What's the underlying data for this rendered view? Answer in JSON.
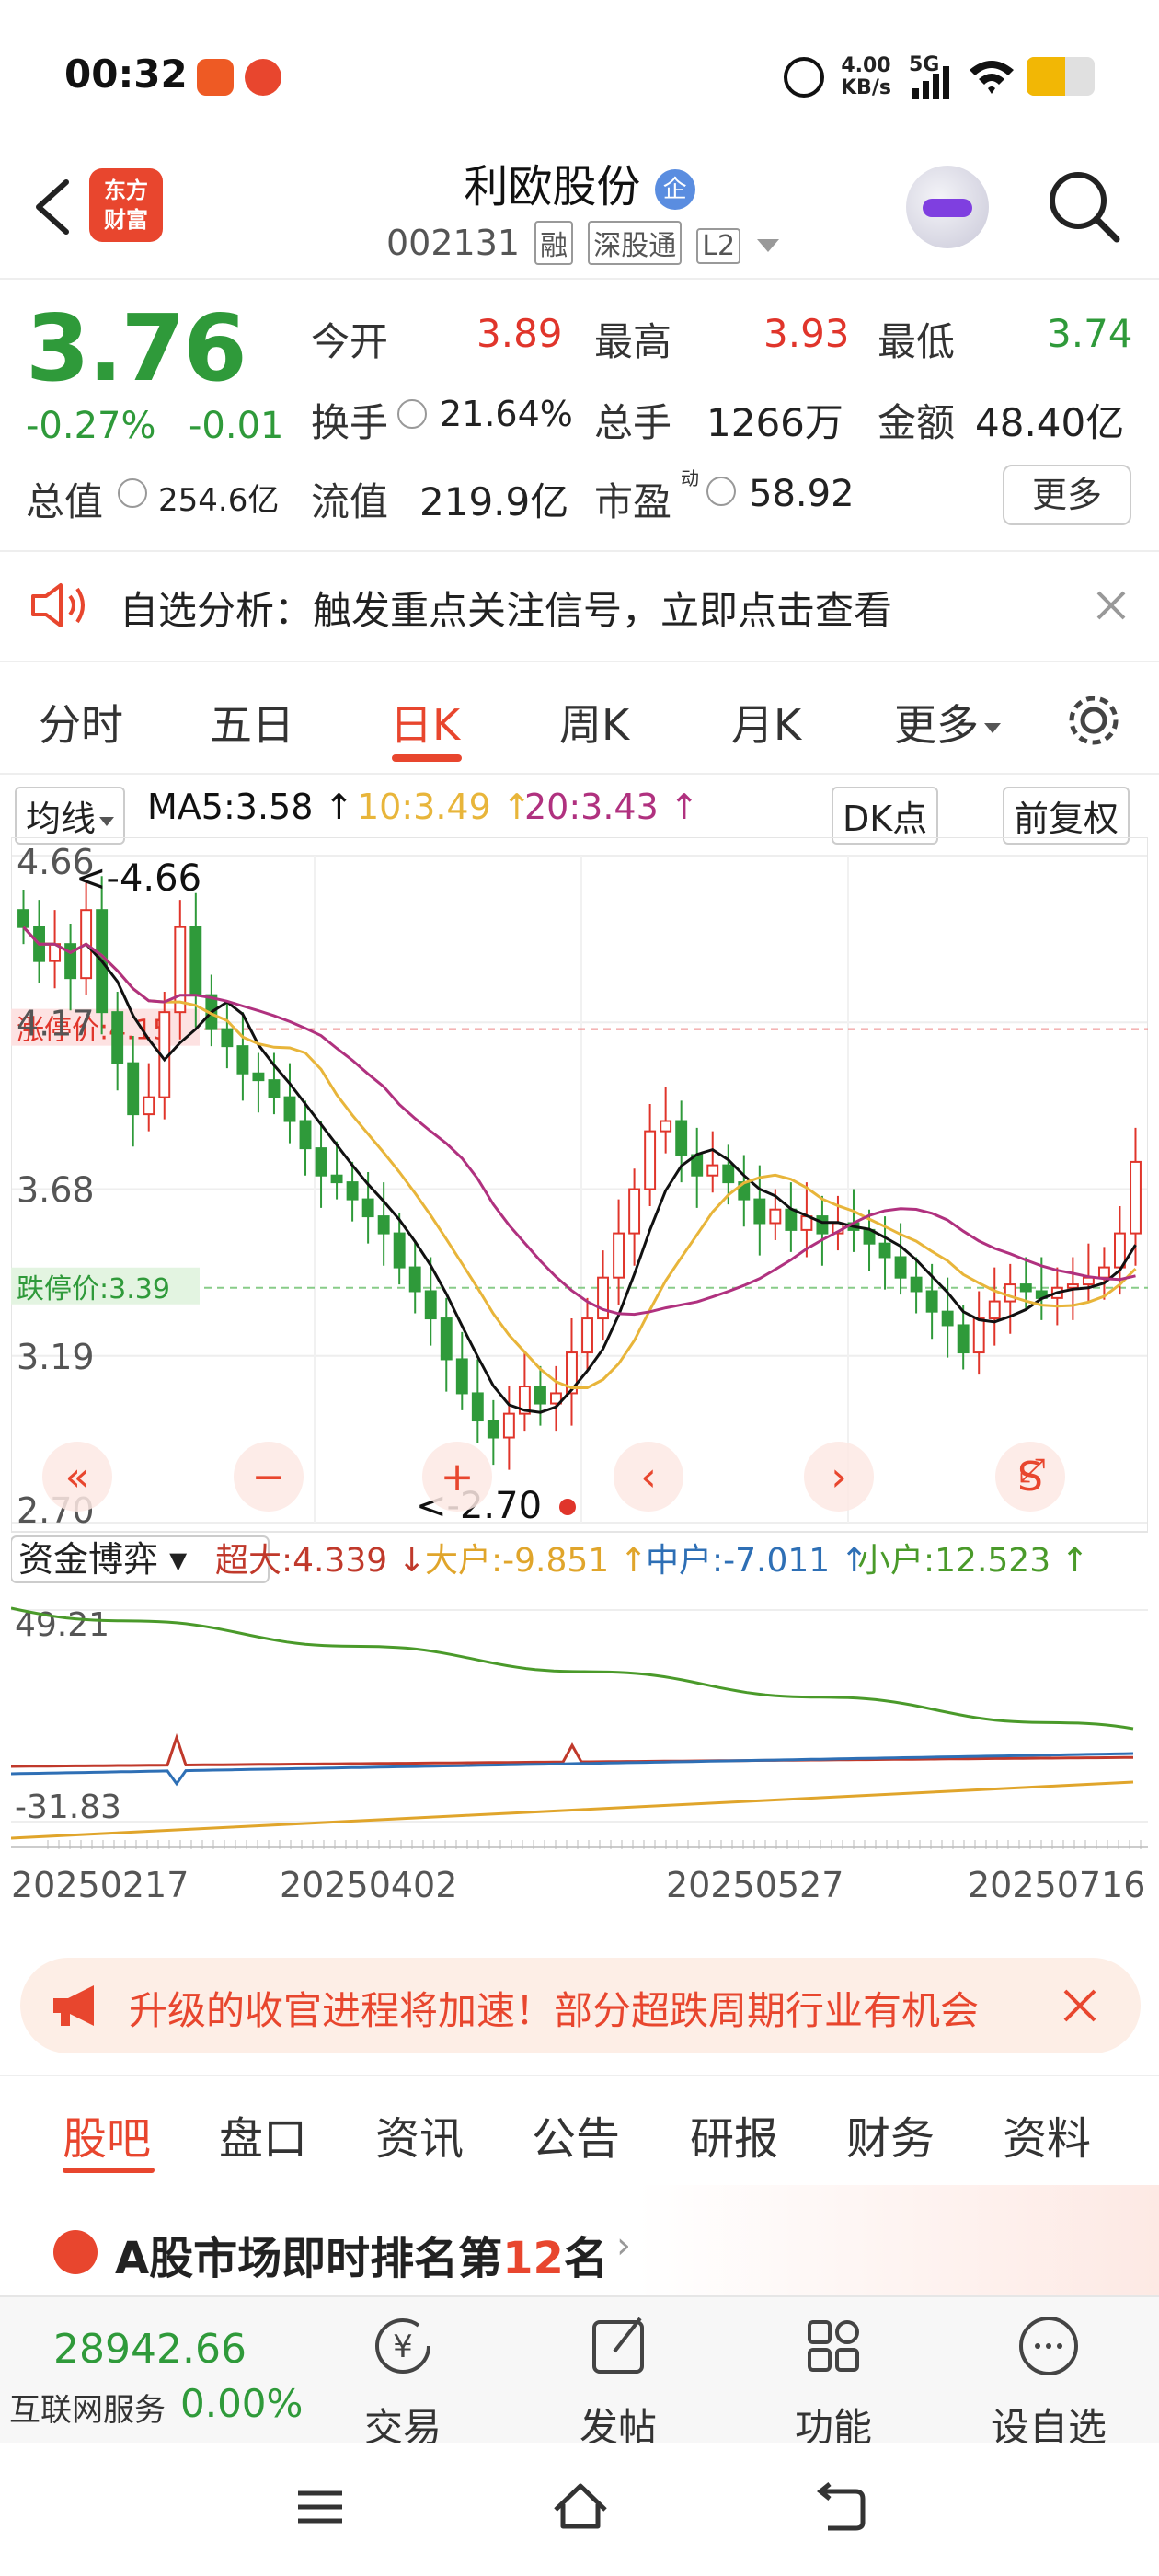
{
  "status_bar": {
    "time": "00:32",
    "net_speed_top": "4.00",
    "net_speed_bottom": "KB/s",
    "net_type": "5G"
  },
  "header": {
    "logo_line1": "东方",
    "logo_line2": "财富",
    "title": "利欧股份",
    "title_badge": "企",
    "code": "002131",
    "tags": [
      "融",
      "深股通",
      "L2"
    ]
  },
  "quote": {
    "price": "3.76",
    "change_pct": "-0.27%",
    "change": "-0.01",
    "items": [
      {
        "label": "今开",
        "value": "3.89",
        "color": "red"
      },
      {
        "label": "最高",
        "value": "3.93",
        "color": "red"
      },
      {
        "label": "最低",
        "value": "3.74",
        "color": "green"
      },
      {
        "label": "换手",
        "value": "21.64%",
        "color": "dark"
      },
      {
        "label": "总手",
        "value": "1266万",
        "color": "dark"
      },
      {
        "label": "金额",
        "value": "48.40亿",
        "color": "dark"
      },
      {
        "label": "总值",
        "value": "254.6亿",
        "color": "dark"
      },
      {
        "label": "流值",
        "value": "219.9亿",
        "color": "dark"
      },
      {
        "label": "市盈",
        "label_sup": "动",
        "value": "58.92",
        "color": "dark"
      }
    ],
    "more_button": "更多"
  },
  "notice": {
    "text": "自选分析：触发重点关注信号，立即点击查看"
  },
  "period_tabs": [
    "分时",
    "五日",
    "日K",
    "周K",
    "月K",
    "更多"
  ],
  "period_active": "日K",
  "ma_row": {
    "selector": "均线",
    "ma5": "MA5:3.58",
    "ma10": "10:3.49",
    "ma20": "20:3.43",
    "dk_button": "DK点",
    "adjust_button": "前复权"
  },
  "chart_data": {
    "type": "candlestick",
    "price_axis_labels": [
      "4.66",
      "4.17",
      "3.68",
      "3.19",
      "2.70"
    ],
    "ylim": [
      2.7,
      4.66
    ],
    "limit_up_label": "涨停价:4.15",
    "limit_down_label": "跌停价:3.39",
    "high_marker": "<-4.66",
    "low_marker": "<-2.70",
    "ma_colors": {
      "ma5": "#111111",
      "ma10": "#e8b53a",
      "ma20": "#b0317f"
    },
    "up_color": "#e0352b",
    "down_color": "#2f9a3a",
    "closes": [
      4.45,
      4.35,
      4.4,
      4.3,
      4.5,
      4.2,
      4.05,
      3.9,
      3.95,
      4.2,
      4.45,
      4.25,
      4.15,
      4.1,
      4.02,
      4.0,
      3.95,
      3.88,
      3.8,
      3.72,
      3.7,
      3.65,
      3.6,
      3.55,
      3.45,
      3.38,
      3.3,
      3.18,
      3.08,
      3.0,
      2.95,
      3.02,
      3.1,
      3.05,
      3.08,
      3.2,
      3.3,
      3.42,
      3.55,
      3.68,
      3.85,
      3.88,
      3.78,
      3.72,
      3.75,
      3.7,
      3.65,
      3.58,
      3.62,
      3.56,
      3.6,
      3.55,
      3.58,
      3.56,
      3.52,
      3.48,
      3.42,
      3.38,
      3.32,
      3.28,
      3.2,
      3.3,
      3.35,
      3.4,
      3.38,
      3.36,
      3.39,
      3.4,
      3.42,
      3.45,
      3.55,
      3.76
    ],
    "subchart": {
      "selector": "资金博弈",
      "legend": [
        {
          "label": "超大:4.339",
          "arrow": "↓",
          "color": "#c0392b"
        },
        {
          "label": "大户:-9.851",
          "arrow": "↑",
          "color": "#e0a52b"
        },
        {
          "label": "中户:-7.011",
          "arrow": "↑",
          "color": "#2e6fb5"
        },
        {
          "label": "小户:12.523",
          "arrow": "↑",
          "color": "#4a9a2a"
        }
      ],
      "axis_labels": [
        "49.21",
        "-31.83"
      ],
      "ylim": [
        -31.83,
        49.21
      ]
    },
    "date_labels": [
      "20250217",
      "20250402",
      "20250527",
      "20250716"
    ],
    "chart_buttons": [
      "«",
      "−",
      "+",
      "‹",
      "›",
      "S",
      "⤢"
    ]
  },
  "ad_bar": {
    "text": "升级的收官进程将加速！部分超跌周期行业有机会"
  },
  "sub_tabs": [
    "股吧",
    "盘口",
    "资讯",
    "公告",
    "研报",
    "财务",
    "资料"
  ],
  "sub_tab_active": "股吧",
  "rank": {
    "prefix": "A股市场即时排名第",
    "number": "12",
    "suffix": "名"
  },
  "toolbar": {
    "index_value": "28942.66",
    "index_name": "互联网服务",
    "index_change": "0.00%",
    "items": [
      "交易",
      "发帖",
      "功能",
      "设自选"
    ]
  }
}
